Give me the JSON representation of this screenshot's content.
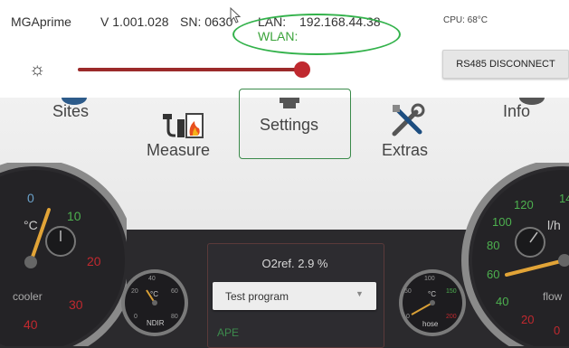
{
  "header": {
    "app_name": "MGAprime",
    "version": "V 1.001.028",
    "serial": "SN: 0630",
    "lan_label": "LAN:",
    "lan_ip": "192.168.44.38",
    "wlan_label": "WLAN:",
    "cpu": "CPU: 68°C"
  },
  "brightness": {
    "icon": "brightness-icon",
    "level": 0.97
  },
  "rs485_button": "RS485 DISCONNECT",
  "menu": {
    "sites": "Sites",
    "measure": "Measure",
    "settings": "Settings",
    "extras": "Extras",
    "info": "Info",
    "selected": "Settings"
  },
  "gauges": {
    "cooler": {
      "label": "cooler",
      "unit": "°C",
      "ticks": [
        "0",
        "10",
        "20",
        "30",
        "40"
      ],
      "value": 11
    },
    "ndir": {
      "label": "NDIR",
      "unit": "°C",
      "ticks": [
        "20",
        "40",
        "60",
        "80",
        "0"
      ]
    },
    "hose": {
      "label": "hose",
      "unit": "°C",
      "ticks": [
        "50",
        "100",
        "150",
        "200",
        "0"
      ]
    },
    "flow": {
      "label": "flow",
      "unit": "l/h",
      "ticks": [
        "140",
        "120",
        "100",
        "80",
        "60",
        "40",
        "20",
        "0"
      ],
      "value": 48
    }
  },
  "panel": {
    "o2ref": "O2ref. 2.9 %",
    "program": "Test program",
    "ape": "APE"
  },
  "colors": {
    "accent_green": "#33b24b",
    "slider_red": "#c0292f"
  }
}
